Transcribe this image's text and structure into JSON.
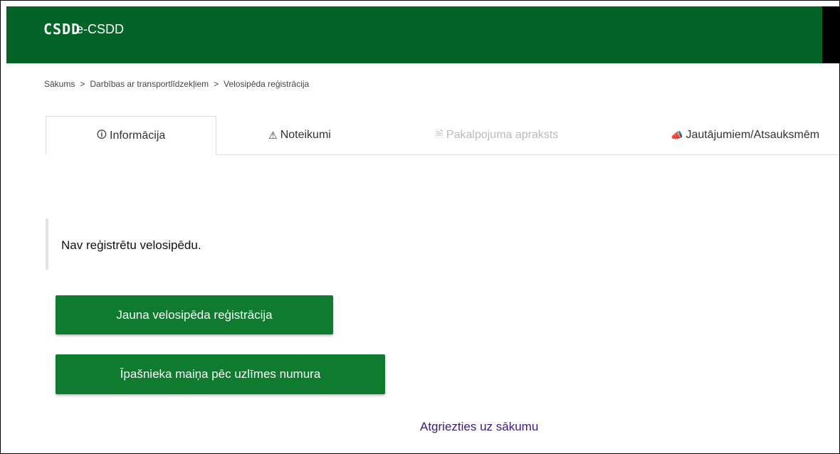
{
  "header": {
    "logo_text": "CSDD",
    "app_title": "e-CSDD",
    "bg_color": "#036428"
  },
  "breadcrumb": {
    "items": [
      "Sākums",
      "Darbības ar transportlīdzekļiem",
      "Velosipēda reģistrācija"
    ],
    "separator": ">"
  },
  "tabs": [
    {
      "label": "Informācija",
      "icon": "info-circle-icon",
      "state": "active"
    },
    {
      "label": "Noteikumi",
      "icon": "warning-icon",
      "state": "normal"
    },
    {
      "label": "Pakalpojuma apraksts",
      "icon": "document-icon",
      "state": "disabled"
    },
    {
      "label": "Jautājumiem/Atsauksmēm",
      "icon": "megaphone-icon",
      "state": "normal"
    }
  ],
  "notice": {
    "text": "Nav reģistrētu velosipēdu."
  },
  "buttons": {
    "new_registration": "Jauna velosipēda reģistrācija",
    "owner_change": "Īpašnieka maiņa pēc uzlīmes numura"
  },
  "back_link": "Atgriezties uz sākumu",
  "colors": {
    "button": "#0f7b2e",
    "link": "#3b1a80"
  }
}
